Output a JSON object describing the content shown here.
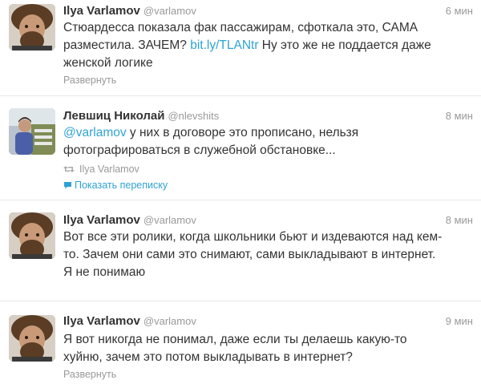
{
  "tweets": [
    {
      "name": "Ilya Varlamov",
      "handle": "@varlamov",
      "time": "6 мин",
      "text_before": "Стюардесса показала фак пассажирам, сфоткала это, САМА\nразместила. ЗАЧЕМ? ",
      "link": "bit.ly/TLANtr",
      "text_after": " Ну это же не поддается даже\nженской логике",
      "action": "Развернуть"
    },
    {
      "name": "Левшиц Николай",
      "handle": "@nlevshits",
      "time": "8 мин",
      "mention": "@varlamov",
      "text_after": " у них в договоре это прописано, нельзя\nфотографироваться в служебной обстановке...",
      "retweeted_by": "Ilya Varlamov",
      "conversation": "Показать переписку"
    },
    {
      "name": "Ilya Varlamov",
      "handle": "@varlamov",
      "time": "8 мин",
      "text": "Вот все эти ролики, когда школьники бьют и издеваются над кем-\nто. Зачем они сами это снимают, сами выкладывают в интернет.\nЯ не понимаю"
    },
    {
      "name": "Ilya Varlamov",
      "handle": "@varlamov",
      "time": "9 мин",
      "text": "Я вот никогда не понимал, даже если ты делаешь какую-то\nхуйню, зачем это потом выкладывать в интернет?",
      "action": "Развернуть"
    }
  ],
  "colors": {
    "link": "#2fa2d5",
    "muted": "#999999",
    "text": "#333333",
    "divider": "#e8e8e8"
  },
  "icons": {
    "retweet": "retweet-icon",
    "conversation": "speech-bubble-icon"
  }
}
